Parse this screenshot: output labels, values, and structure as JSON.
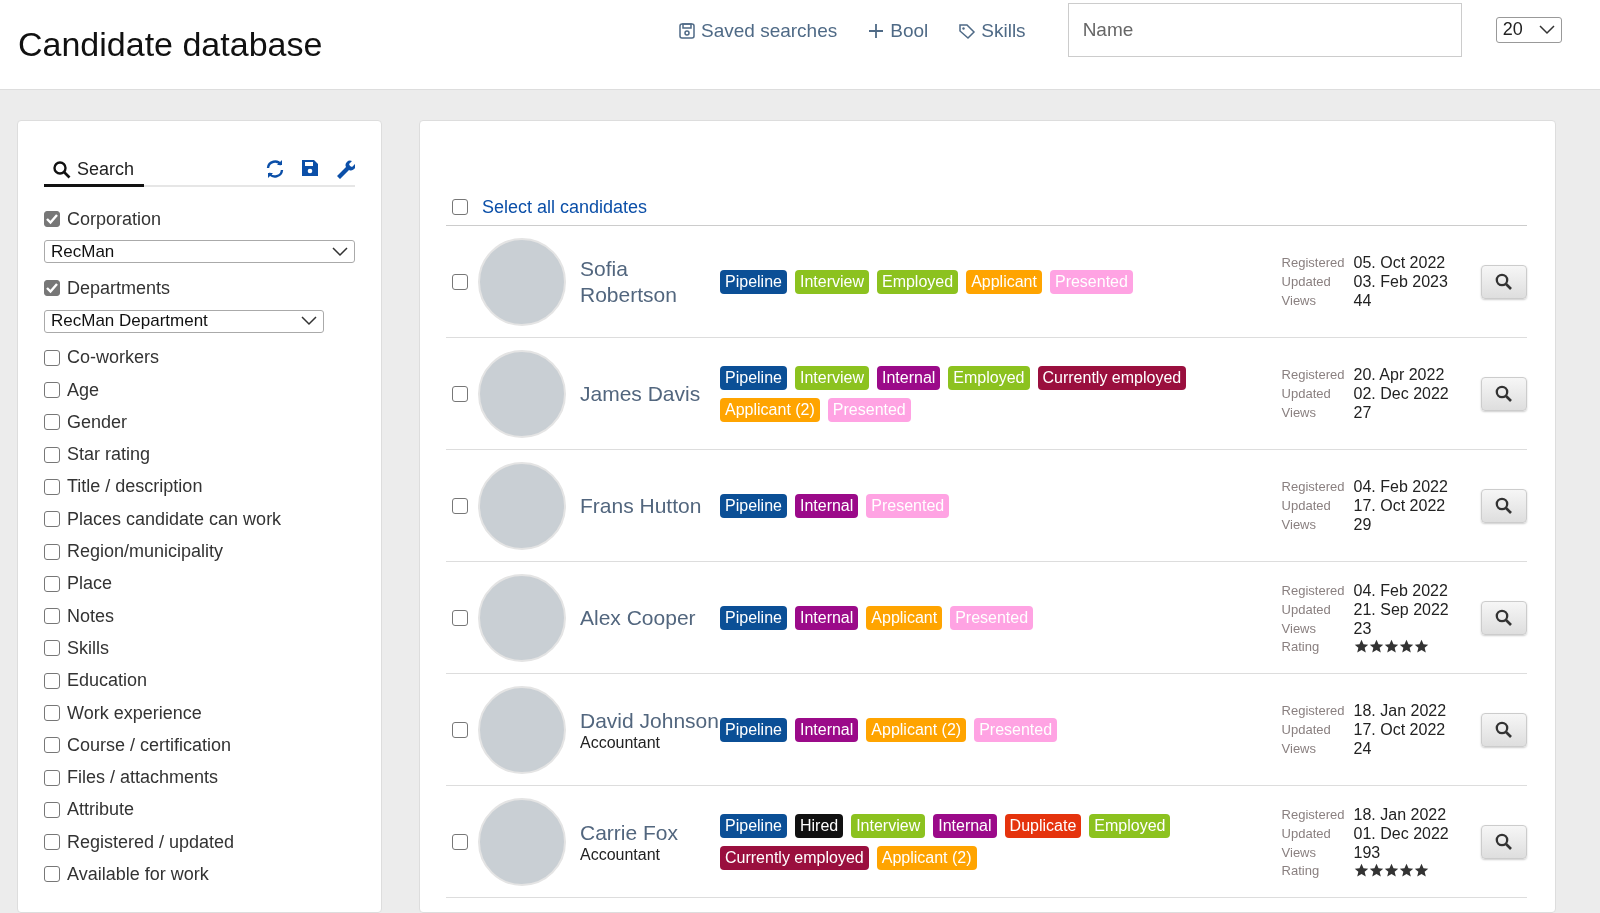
{
  "header": {
    "title": "Candidate database",
    "links": [
      {
        "label": "Saved searches"
      },
      {
        "label": "Bool"
      },
      {
        "label": "Skills"
      }
    ],
    "name_field": {
      "placeholder": "Name"
    },
    "page_size": "20"
  },
  "filters": {
    "tab": "Search",
    "items": [
      {
        "kind": "checkbox",
        "label": "Corporation",
        "checked": true
      },
      {
        "kind": "select",
        "value": "RecMan"
      },
      {
        "kind": "checkbox",
        "label": "Departments",
        "checked": true
      },
      {
        "kind": "select",
        "value": "RecMan Department"
      },
      {
        "kind": "checkbox",
        "label": "Co-workers",
        "checked": false
      },
      {
        "kind": "checkbox",
        "label": "Age",
        "checked": false
      },
      {
        "kind": "checkbox",
        "label": "Gender",
        "checked": false
      },
      {
        "kind": "checkbox",
        "label": "Star rating",
        "checked": false
      },
      {
        "kind": "checkbox",
        "label": "Title / description",
        "checked": false
      },
      {
        "kind": "checkbox",
        "label": "Places candidate can work",
        "checked": false
      },
      {
        "kind": "checkbox",
        "label": "Region/municipality",
        "checked": false
      },
      {
        "kind": "checkbox",
        "label": "Place",
        "checked": false
      },
      {
        "kind": "checkbox",
        "label": "Notes",
        "checked": false
      },
      {
        "kind": "checkbox",
        "label": "Skills",
        "checked": false
      },
      {
        "kind": "checkbox",
        "label": "Education",
        "checked": false
      },
      {
        "kind": "checkbox",
        "label": "Work experience",
        "checked": false
      },
      {
        "kind": "checkbox",
        "label": "Course / certification",
        "checked": false
      },
      {
        "kind": "checkbox",
        "label": "Files / attachments",
        "checked": false
      },
      {
        "kind": "checkbox",
        "label": "Attribute",
        "checked": false
      },
      {
        "kind": "checkbox",
        "label": "Registered / updated",
        "checked": false
      },
      {
        "kind": "checkbox",
        "label": "Available for work",
        "checked": false
      }
    ]
  },
  "results": {
    "select_all": {
      "label": "Select all candidates",
      "checked": false
    },
    "candidates": [
      {
        "name": "Sofia Robertson",
        "checked": false,
        "tags": [
          {
            "label": "Pipeline",
            "color": "#0b4f96"
          },
          {
            "label": "Interview",
            "color": "#8cc21f"
          },
          {
            "label": "Employed",
            "color": "#8cc21f"
          },
          {
            "label": "Applicant",
            "color": "#ffa400"
          },
          {
            "label": "Presented",
            "color": "#ffa3e3"
          }
        ],
        "meta": [
          {
            "label": "Registered",
            "value": "05. Oct 2022"
          },
          {
            "label": "Updated",
            "value": "03. Feb 2023"
          },
          {
            "label": "Views",
            "value": "44"
          }
        ]
      },
      {
        "name": "James Davis",
        "checked": false,
        "tags": [
          {
            "label": "Pipeline",
            "color": "#0b4f96"
          },
          {
            "label": "Interview",
            "color": "#8cc21f"
          },
          {
            "label": "Internal",
            "color": "#9b0a89"
          },
          {
            "label": "Employed",
            "color": "#8cc21f"
          },
          {
            "label": "Currently employed",
            "color": "#9a0f3e"
          },
          {
            "label": "Applicant (2)",
            "color": "#ffa400"
          },
          {
            "label": "Presented",
            "color": "#ffa3e3"
          }
        ],
        "meta": [
          {
            "label": "Registered",
            "value": "20. Apr 2022"
          },
          {
            "label": "Updated",
            "value": "02. Dec 2022"
          },
          {
            "label": "Views",
            "value": "27"
          }
        ]
      },
      {
        "name": "Frans Hutton",
        "checked": false,
        "tags": [
          {
            "label": "Pipeline",
            "color": "#0b4f96"
          },
          {
            "label": "Internal",
            "color": "#9b0a89"
          },
          {
            "label": "Presented",
            "color": "#ffa3e3"
          }
        ],
        "meta": [
          {
            "label": "Registered",
            "value": "04. Feb 2022"
          },
          {
            "label": "Updated",
            "value": "17. Oct 2022"
          },
          {
            "label": "Views",
            "value": "29"
          }
        ]
      },
      {
        "name": "Alex Cooper",
        "checked": false,
        "tags": [
          {
            "label": "Pipeline",
            "color": "#0b4f96"
          },
          {
            "label": "Internal",
            "color": "#9b0a89"
          },
          {
            "label": "Applicant",
            "color": "#ffa400"
          },
          {
            "label": "Presented",
            "color": "#ffa3e3"
          }
        ],
        "meta": [
          {
            "label": "Registered",
            "value": "04. Feb 2022"
          },
          {
            "label": "Updated",
            "value": "21. Sep 2022"
          },
          {
            "label": "Views",
            "value": "23"
          },
          {
            "label": "Rating",
            "stars": 5
          }
        ]
      },
      {
        "name": "David Johnson",
        "title": "Accountant",
        "checked": false,
        "tags": [
          {
            "label": "Pipeline",
            "color": "#0b4f96"
          },
          {
            "label": "Internal",
            "color": "#9b0a89"
          },
          {
            "label": "Applicant (2)",
            "color": "#ffa400"
          },
          {
            "label": "Presented",
            "color": "#ffa3e3"
          }
        ],
        "meta": [
          {
            "label": "Registered",
            "value": "18. Jan 2022"
          },
          {
            "label": "Updated",
            "value": "17. Oct 2022"
          },
          {
            "label": "Views",
            "value": "24"
          }
        ]
      },
      {
        "name": "Carrie Fox",
        "title": "Accountant",
        "checked": false,
        "tags": [
          {
            "label": "Pipeline",
            "color": "#0b4f96"
          },
          {
            "label": "Hired",
            "color": "#111111"
          },
          {
            "label": "Interview",
            "color": "#8cc21f"
          },
          {
            "label": "Internal",
            "color": "#9b0a89"
          },
          {
            "label": "Duplicate",
            "color": "#e5330d"
          },
          {
            "label": "Employed",
            "color": "#8cc21f"
          },
          {
            "label": "Currently employed",
            "color": "#9a0f3e"
          },
          {
            "label": "Applicant (2)",
            "color": "#ffa400"
          }
        ],
        "meta": [
          {
            "label": "Registered",
            "value": "18. Jan 2022"
          },
          {
            "label": "Updated",
            "value": "01. Dec 2022"
          },
          {
            "label": "Views",
            "value": "193"
          },
          {
            "label": "Rating",
            "stars": 5
          }
        ]
      }
    ]
  }
}
